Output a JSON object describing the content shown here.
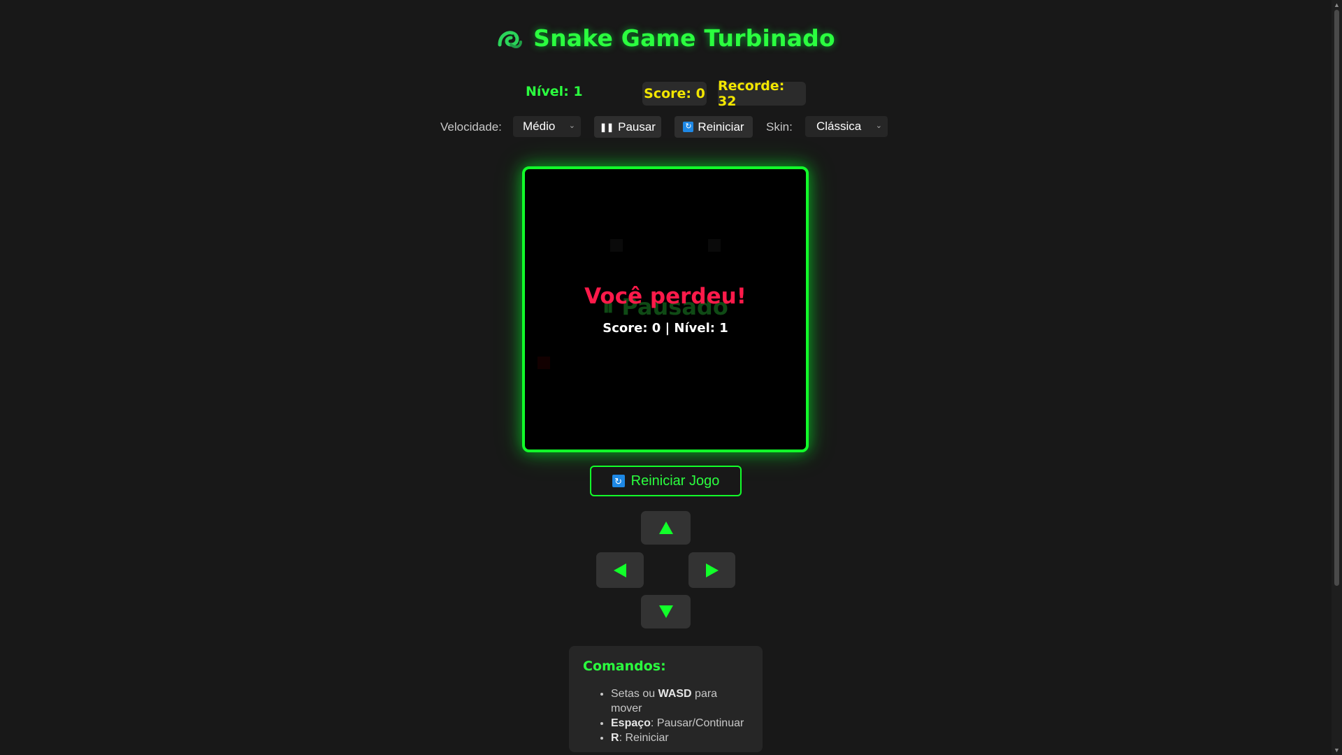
{
  "header": {
    "title": "Snake Game Turbinado",
    "icon": "snake-icon"
  },
  "stats": {
    "level": "Nível: 1",
    "score": "Score: 0",
    "record": "Recorde: 32"
  },
  "controls": {
    "speed_label": "Velocidade:",
    "speed_value": "Médio",
    "pause_label": "Pausar",
    "restart_label": "Reiniciar",
    "skin_label": "Skin:",
    "skin_value": "Clássica"
  },
  "board": {
    "paused_text": "⏸ Pausado",
    "gameover_title": "Você perdeu!",
    "gameover_sub": "Score: 0 | Nível: 1"
  },
  "restart_game_label": "Reiniciar Jogo",
  "dpad": {
    "up": "arrow-up-icon",
    "down": "arrow-down-icon",
    "left": "arrow-left-icon",
    "right": "arrow-right-icon"
  },
  "commands": {
    "title": "Comandos:",
    "items": [
      {
        "pre": "Setas ou ",
        "key": "WASD",
        "post": " para mover"
      },
      {
        "pre": "",
        "key": "Espaço",
        "post": ": Pausar/Continuar"
      },
      {
        "pre": "",
        "key": "R",
        "post": ": Reiniciar"
      }
    ]
  },
  "colors": {
    "accent": "#12ff2a",
    "score": "#f2e600",
    "gameover": "#ff1a4a",
    "background": "#181818"
  }
}
